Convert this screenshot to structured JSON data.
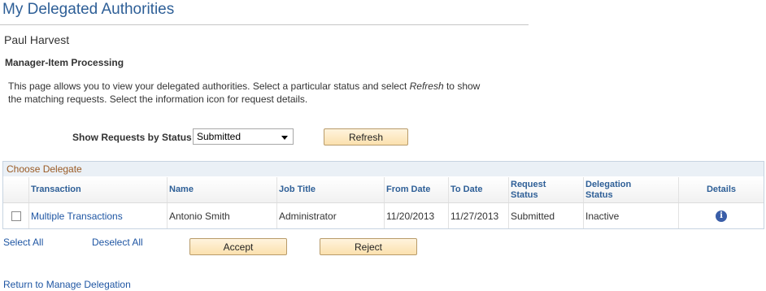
{
  "page": {
    "title": "My Delegated Authorities",
    "person_name": "Paul Harvest",
    "section_label": "Manager-Item Processing",
    "description_part1": "This page allows you to view your delegated authorities. Select a particular status and select ",
    "description_emphasis": "Refresh",
    "description_part2": " to show the matching requests. Select the information icon for request details."
  },
  "filter": {
    "label": "Show Requests by Status",
    "selected": "Submitted",
    "refresh_label": "Refresh"
  },
  "grid": {
    "caption": "Choose Delegate",
    "columns": {
      "transaction": "Transaction",
      "name": "Name",
      "job_title": "Job Title",
      "from_date": "From Date",
      "to_date": "To Date",
      "request_status": "Request Status",
      "delegation_status": "Delegation Status",
      "details": "Details"
    },
    "rows": [
      {
        "checked": false,
        "transaction": "Multiple Transactions",
        "name": "Antonio Smith",
        "job_title": "Administrator",
        "from_date": "11/20/2013",
        "to_date": "11/27/2013",
        "request_status": "Submitted",
        "delegation_status": "Inactive",
        "details_icon": "info-icon"
      }
    ]
  },
  "actions": {
    "select_all": "Select All",
    "deselect_all": "Deselect All",
    "accept": "Accept",
    "reject": "Reject",
    "return_link": "Return to Manage Delegation"
  },
  "colors": {
    "title_blue": "#2e5f97",
    "link_blue": "#1f56a3",
    "caption_brown": "#9a5a24",
    "button_fill": "#fbe1ae"
  }
}
